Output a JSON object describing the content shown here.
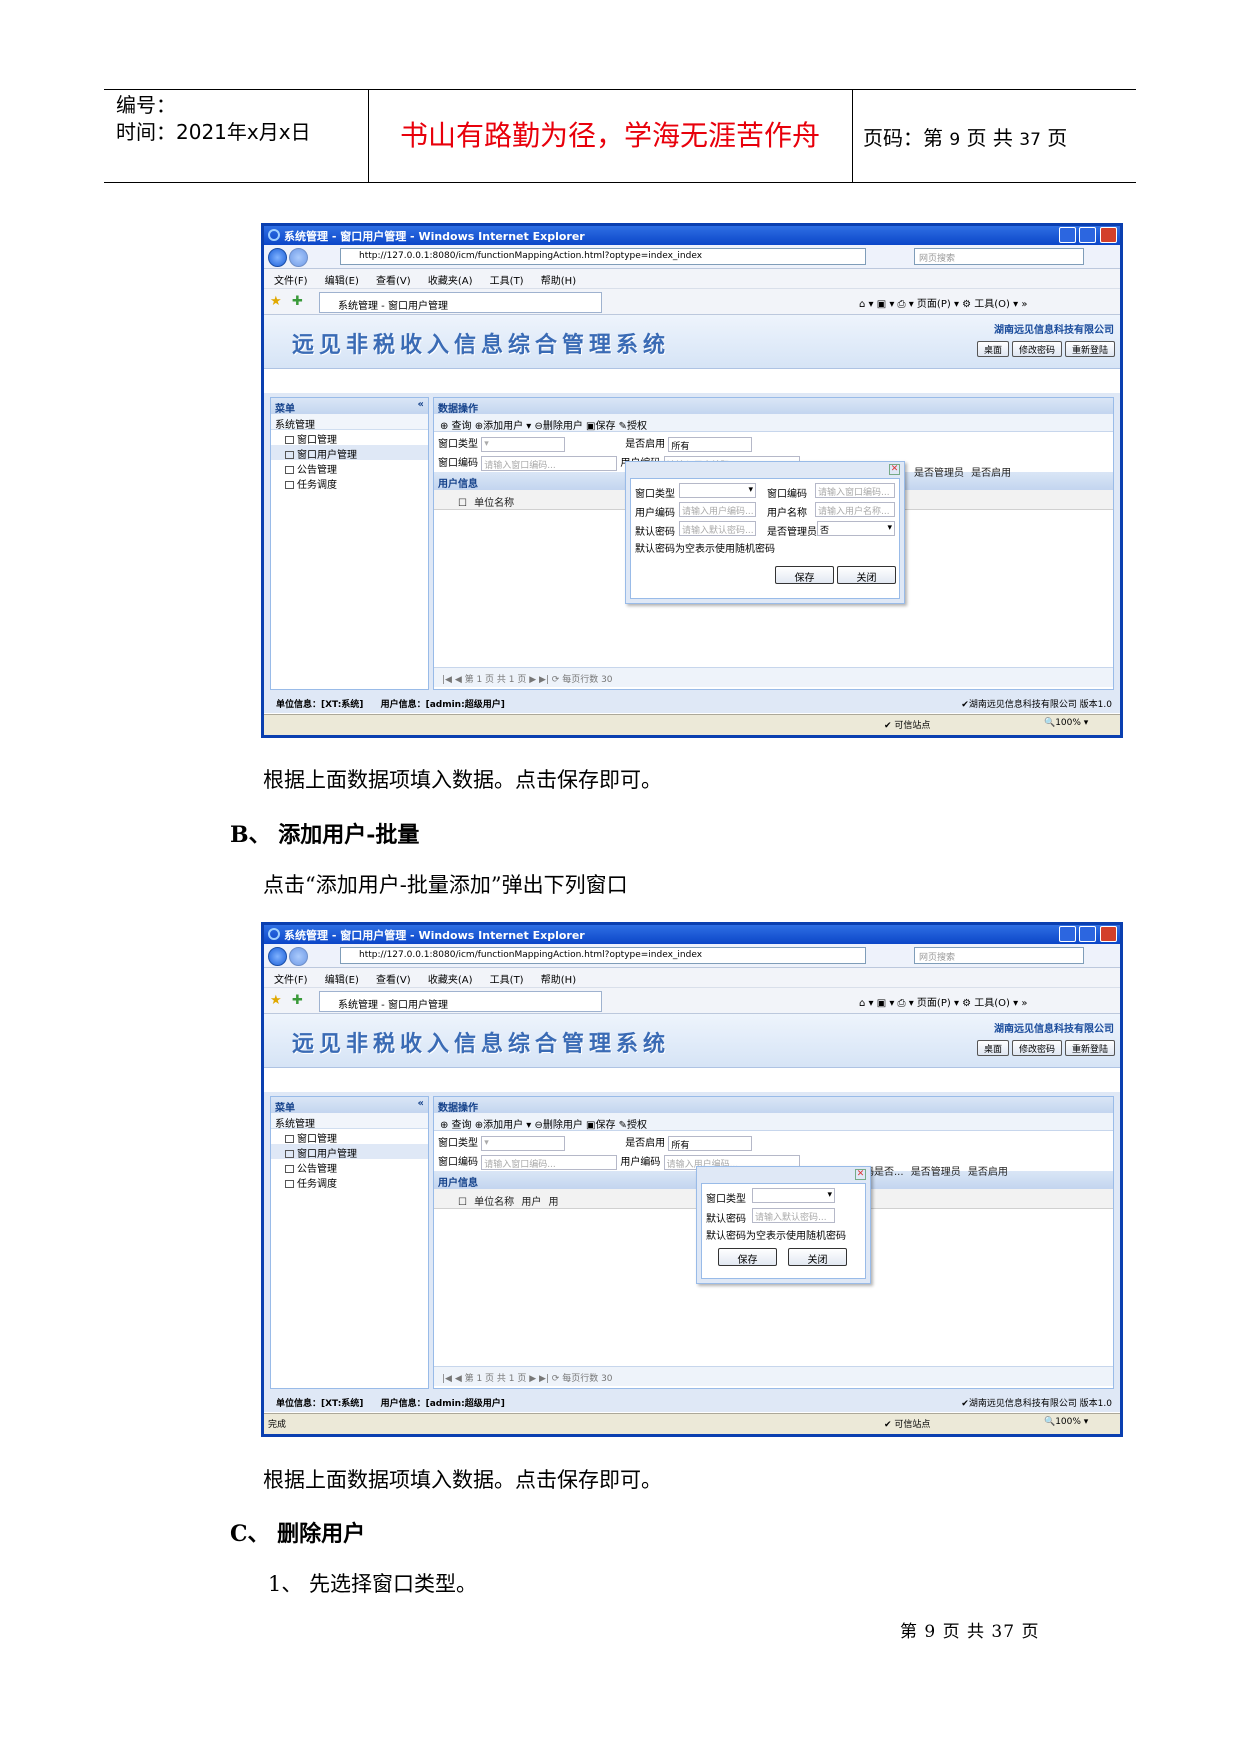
{
  "header": {
    "number_label": "编号：",
    "time_label": "时间：2021年x月x日",
    "motto": "书山有路勤为径，学海无涯苦作舟",
    "page_prefix": "页码：第",
    "page_num": "9",
    "page_mid": "页  共",
    "page_total": "37",
    "page_suffix": "页"
  },
  "window": {
    "title": "系统管理 - 窗口用户管理 - Windows Internet Explorer",
    "url": "http://127.0.0.1:8080/icm/functionMappingAction.html?optype=index_index",
    "search_placeholder": "网页搜索",
    "menu": "文件(F) 编辑(E) 查看(V) 收藏夹(A) 工具(T) 帮助(H)",
    "tab_label": "系统管理 - 窗口用户管理",
    "fav_right": "⌂ ▾ ▣ ▾ ⎙ ▾ 页面(P) ▾ ⚙ 工具(O) ▾ »",
    "app_title": "远见非税收入信息综合管理系统",
    "company": "湖南远见信息科技有限公司",
    "btn_desktop": "桌面",
    "btn_change_pwd": "修改密码",
    "btn_relogin": "重新登陆",
    "menu_header": "菜单",
    "menu_group": "系统管理",
    "menu_items": [
      "窗口管理",
      "窗口用户管理",
      "公告管理",
      "任务调度"
    ],
    "data_header": "数据操作",
    "toolbar": "⊕ 查询 ⊕添加用户 ▾ ⊖删除用户 ▣保存 ✎授权",
    "f_win_type": "窗口类型",
    "f_enabled": "是否启用",
    "f_enabled_val": "所有",
    "f_win_code": "窗口编码",
    "f_win_code_ph": "请输入窗口编码...",
    "f_user_code": "用户编码",
    "f_user_code_ph": "请输入用户编码...",
    "user_info": "用户信息",
    "pager": "|◀ ◀ 第 1 页 共 1 页 ▶ ▶| ⟳ 每页行数 30",
    "status_app_unit": "单位信息：[XT:系统]",
    "status_app_user": "用户信息：[admin:超级用户]",
    "status_app_right": "✔湖南远见信息科技有限公司 版本1.0",
    "trusted": "✔ 可信站点",
    "zoom": "🔍100% ▾",
    "done": "完成",
    "btn_save": "保存",
    "btn_close": "关闭",
    "lbl_user_code": "用户编码",
    "lbl_user_name": "用户名称",
    "ph_user_name": "请输入用户名称...",
    "lbl_default_pwd": "默认密码",
    "ph_default_pwd": "请输入默认密码...",
    "lbl_is_admin": "是否管理员",
    "val_no": "否",
    "pwd_hint": "默认密码为空表示使用随机密码"
  },
  "shot1": {
    "columns": "单位名称",
    "columns_right": "是否管理员  是否启用"
  },
  "shot2": {
    "columns": "单位名称                  用户           用",
    "columns_right": "密码是否...   是否管理员   是否启用"
  },
  "text": {
    "para1": "根据上面数据项填入数据。点击保存即可。",
    "headB": "B、 添加用户-批量",
    "para2": "点击“添加用户-批量添加”弹出下列窗口",
    "para3": "根据上面数据项填入数据。点击保存即可。",
    "headC": "C、 删除用户",
    "item1": "1、  先选择窗口类型。"
  },
  "footer": "第 9 页 共 37 页"
}
